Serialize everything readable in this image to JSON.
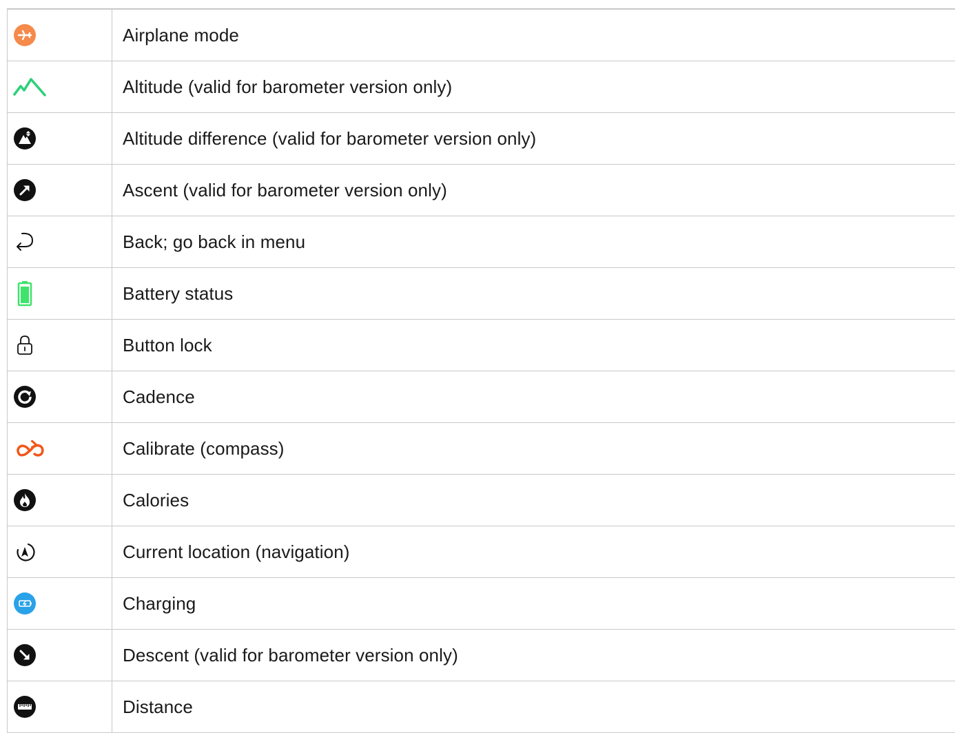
{
  "rows": [
    {
      "icon": "airplane-mode-icon",
      "label": "Airplane mode"
    },
    {
      "icon": "altitude-icon",
      "label": "Altitude (valid for barometer version only)"
    },
    {
      "icon": "altitude-difference-icon",
      "label": "Altitude difference (valid for barometer version only)"
    },
    {
      "icon": "ascent-icon",
      "label": "Ascent (valid for barometer version only)"
    },
    {
      "icon": "back-icon",
      "label": "Back; go back in menu"
    },
    {
      "icon": "battery-icon",
      "label": "Battery status"
    },
    {
      "icon": "button-lock-icon",
      "label": "Button lock"
    },
    {
      "icon": "cadence-icon",
      "label": "Cadence"
    },
    {
      "icon": "calibrate-compass-icon",
      "label": "Calibrate (compass)"
    },
    {
      "icon": "calories-icon",
      "label": "Calories"
    },
    {
      "icon": "current-location-icon",
      "label": "Current location (navigation)"
    },
    {
      "icon": "charging-icon",
      "label": "Charging"
    },
    {
      "icon": "descent-icon",
      "label": "Descent (valid for barometer version only)"
    },
    {
      "icon": "distance-icon",
      "label": "Distance"
    }
  ],
  "colors": {
    "airplane": "#f58a4b",
    "altitude": "#2fd07a",
    "battery": "#3ee36b",
    "calibrate": "#f2571b",
    "charging": "#2aa2e8",
    "dark": "#111111"
  }
}
